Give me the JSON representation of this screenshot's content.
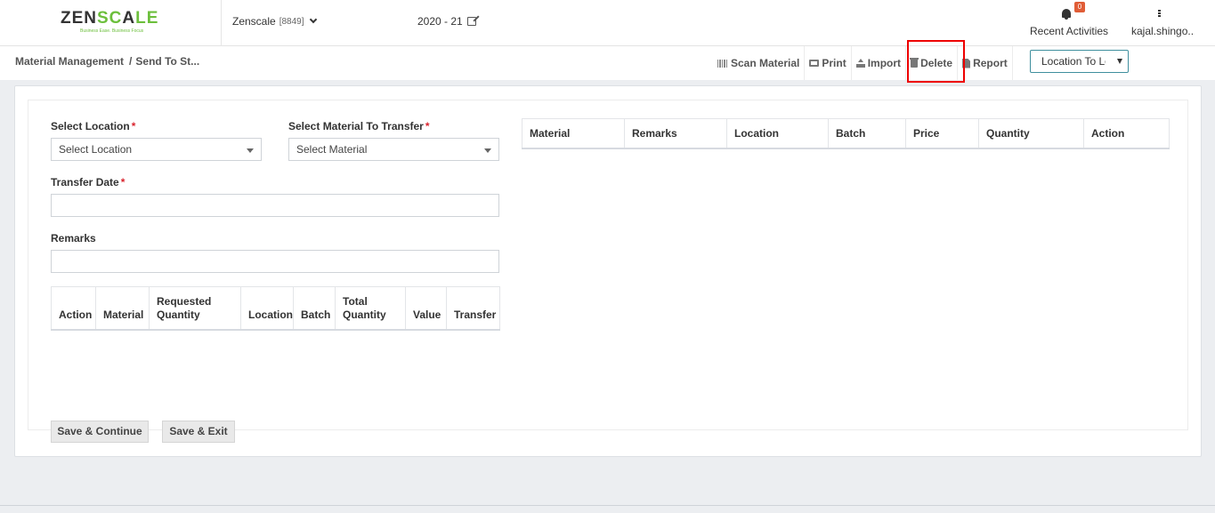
{
  "brand": {
    "logo": "ZENSCALE",
    "tagline": "Business Ease. Business Focus"
  },
  "header": {
    "company_name": "Zenscale",
    "company_code": "[8849]",
    "financial_year": "2020 - 21",
    "notifications_count": "0",
    "recent_activities": "Recent Activities",
    "user": "kajal.shingo.."
  },
  "breadcrumb": {
    "root": "Material Management",
    "separator": "/",
    "current": "Send To St..."
  },
  "toolbar": {
    "scan": "Scan Material",
    "print": "Print",
    "import": "Import",
    "delete": "Delete",
    "report": "Report",
    "transfer_type": "Location To Location"
  },
  "form": {
    "location_label": "Select Location",
    "location_placeholder": "Select Location",
    "material_label": "Select Material To Transfer",
    "material_placeholder": "Select Material",
    "date_label": "Transfer Date",
    "remarks_label": "Remarks",
    "required_mark": "*"
  },
  "transfer_table": {
    "columns": [
      "Action",
      "Material",
      "Requested Quantity",
      "Location",
      "Batch",
      "Total Quantity",
      "Value",
      "Transfer"
    ]
  },
  "material_table": {
    "columns": [
      "Material",
      "Remarks",
      "Location",
      "Batch",
      "Price",
      "Quantity",
      "Action"
    ]
  },
  "actions": {
    "save_continue": "Save & Continue",
    "save_exit": "Save & Exit"
  },
  "colors": {
    "accent": "#3f8f9e",
    "required": "#d9232d",
    "highlight": "#e00000",
    "badge": "#e05d37"
  }
}
